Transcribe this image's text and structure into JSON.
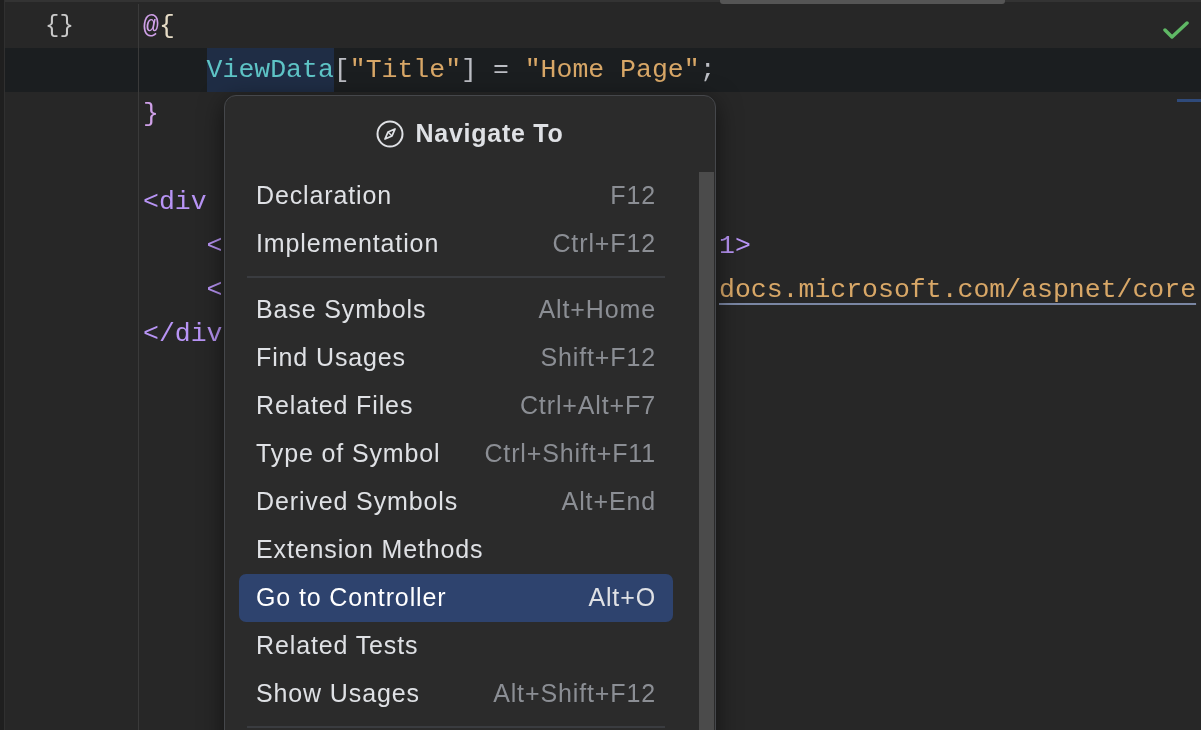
{
  "editor": {
    "lines": [
      {
        "kind": "code",
        "current": false,
        "gutter_mark": "{}",
        "tokens": [
          {
            "text": "@",
            "kind": "razor",
            "highlighted": false
          },
          {
            "text": "{",
            "kind": "brace",
            "highlighted": false
          }
        ],
        "children": [
          {
            "kind": "code",
            "current": true,
            "tokens": [
              {
                "text": "ViewData",
                "kind": "identifier",
                "highlighted": true
              },
              {
                "text": "[",
                "kind": "punct",
                "highlighted": false
              },
              {
                "text": "\"Title\"",
                "kind": "string",
                "highlighted": false
              },
              {
                "text": "] = ",
                "kind": "punct",
                "highlighted": false
              },
              {
                "text": "\"Home Page\"",
                "kind": "string",
                "highlighted": false
              },
              {
                "text": ";",
                "kind": "punct",
                "highlighted": false
              }
            ]
          }
        ]
      },
      {
        "kind": "code",
        "current": false,
        "tokens": [
          {
            "text": "}",
            "kind": "razor",
            "highlighted": false
          }
        ]
      },
      {
        "kind": "blank",
        "current": false
      },
      {
        "kind": "code",
        "current": false,
        "tokens": [
          {
            "text": "<div",
            "kind": "tag",
            "highlighted": false
          }
        ],
        "children": [
          {
            "kind": "code",
            "current": false,
            "tokens": [
              {
                "text": "<",
                "kind": "tag",
                "highlighted": false
              }
            ],
            "tokens_after_menu": [
              {
                "text": "1>",
                "kind": "tag",
                "highlighted": false
              }
            ]
          },
          {
            "kind": "code",
            "current": false,
            "tokens": [
              {
                "text": "<",
                "kind": "tag",
                "highlighted": false
              }
            ],
            "tokens_after_menu": [
              {
                "text": "docs.microsoft.com/aspnet/core",
                "kind": "link",
                "highlighted": false
              }
            ]
          }
        ]
      },
      {
        "kind": "code",
        "current": false,
        "tokens": [
          {
            "text": "</div",
            "kind": "tag",
            "highlighted": false
          }
        ]
      }
    ]
  },
  "menu": {
    "title": "Navigate To",
    "items": [
      {
        "kind": "item",
        "label": "Declaration",
        "shortcut": "F12",
        "selected": false
      },
      {
        "kind": "item",
        "label": "Implementation",
        "shortcut": "Ctrl+F12",
        "selected": false
      },
      {
        "kind": "separator"
      },
      {
        "kind": "item",
        "label": "Base Symbols",
        "shortcut": "Alt+Home",
        "selected": false
      },
      {
        "kind": "item",
        "label": "Find Usages",
        "shortcut": "Shift+F12",
        "selected": false
      },
      {
        "kind": "item",
        "label": "Related Files",
        "shortcut": "Ctrl+Alt+F7",
        "selected": false
      },
      {
        "kind": "item",
        "label": "Type of Symbol",
        "shortcut": "Ctrl+Shift+F11",
        "selected": false
      },
      {
        "kind": "item",
        "label": "Derived Symbols",
        "shortcut": "Alt+End",
        "selected": false
      },
      {
        "kind": "item",
        "label": "Extension Methods",
        "selected": false
      },
      {
        "kind": "item",
        "label": "Go to Controller",
        "shortcut": "Alt+O",
        "selected": true
      },
      {
        "kind": "item",
        "label": "Related Tests",
        "selected": false
      },
      {
        "kind": "item",
        "label": "Show Usages",
        "shortcut": "Alt+Shift+F12",
        "selected": false
      },
      {
        "kind": "separator"
      }
    ]
  }
}
